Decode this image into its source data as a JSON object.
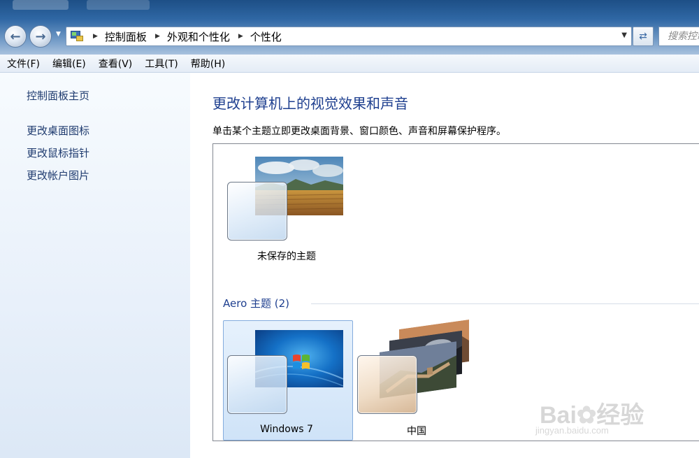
{
  "address_bar": {
    "breadcrumbs": [
      "控制面板",
      "外观和个性化",
      "个性化"
    ],
    "search_placeholder": "搜索控制"
  },
  "menu": [
    "文件(F)",
    "编辑(E)",
    "查看(V)",
    "工具(T)",
    "帮助(H)"
  ],
  "sidebar": {
    "home": "控制面板主页",
    "links": [
      "更改桌面图标",
      "更改鼠标指针",
      "更改帐户图片"
    ]
  },
  "main": {
    "title": "更改计算机上的视觉效果和声音",
    "description": "单击某个主题立即更改桌面背景、窗口颜色、声音和屏幕保护程序。",
    "unsaved_theme": {
      "label": "未保存的主题"
    },
    "aero_group": {
      "label": "Aero 主题 (2)",
      "themes": [
        {
          "label": "Windows 7",
          "selected": true
        },
        {
          "label": "中国",
          "selected": false
        }
      ]
    }
  },
  "watermark": {
    "brand": "Bai du 经验",
    "url": "jingyan.baidu.com"
  }
}
